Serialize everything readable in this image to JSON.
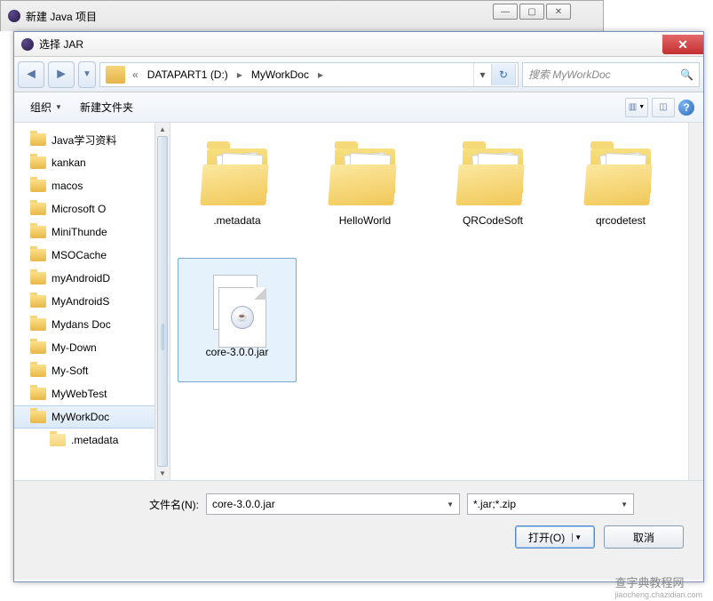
{
  "parent_window": {
    "title": "新建 Java 项目"
  },
  "dialog": {
    "title": "选择 JAR"
  },
  "breadcrumb": {
    "drive": "DATAPART1 (D:)",
    "folder": "MyWorkDoc"
  },
  "search": {
    "placeholder": "搜索 MyWorkDoc"
  },
  "toolbar": {
    "organize": "组织",
    "new_folder": "新建文件夹"
  },
  "tree": {
    "items": [
      {
        "label": "Java学习资料"
      },
      {
        "label": "kankan"
      },
      {
        "label": "macos"
      },
      {
        "label": "Microsoft O"
      },
      {
        "label": "MiniThunde"
      },
      {
        "label": "MSOCache"
      },
      {
        "label": "myAndroidD"
      },
      {
        "label": "MyAndroidS"
      },
      {
        "label": "Mydans Doc"
      },
      {
        "label": "My-Down"
      },
      {
        "label": "My-Soft"
      },
      {
        "label": "MyWebTest"
      },
      {
        "label": "MyWorkDoc",
        "selected": true
      },
      {
        "label": ".metadata",
        "sub": true
      }
    ]
  },
  "grid": {
    "items": [
      {
        "label": ".metadata",
        "type": "folder"
      },
      {
        "label": "HelloWorld",
        "type": "folder"
      },
      {
        "label": "QRCodeSoft",
        "type": "folder"
      },
      {
        "label": "qrcodetest",
        "type": "folder"
      },
      {
        "label": "core-3.0.0.jar",
        "type": "jar",
        "selected": true
      }
    ]
  },
  "bottom": {
    "filename_label": "文件名(N):",
    "filename_value": "core-3.0.0.jar",
    "filter": "*.jar;*.zip",
    "open": "打开(O)",
    "cancel": "取消"
  },
  "watermark": {
    "line1": "查字典教程网",
    "line2": "jiaocheng.chazidian.com"
  }
}
